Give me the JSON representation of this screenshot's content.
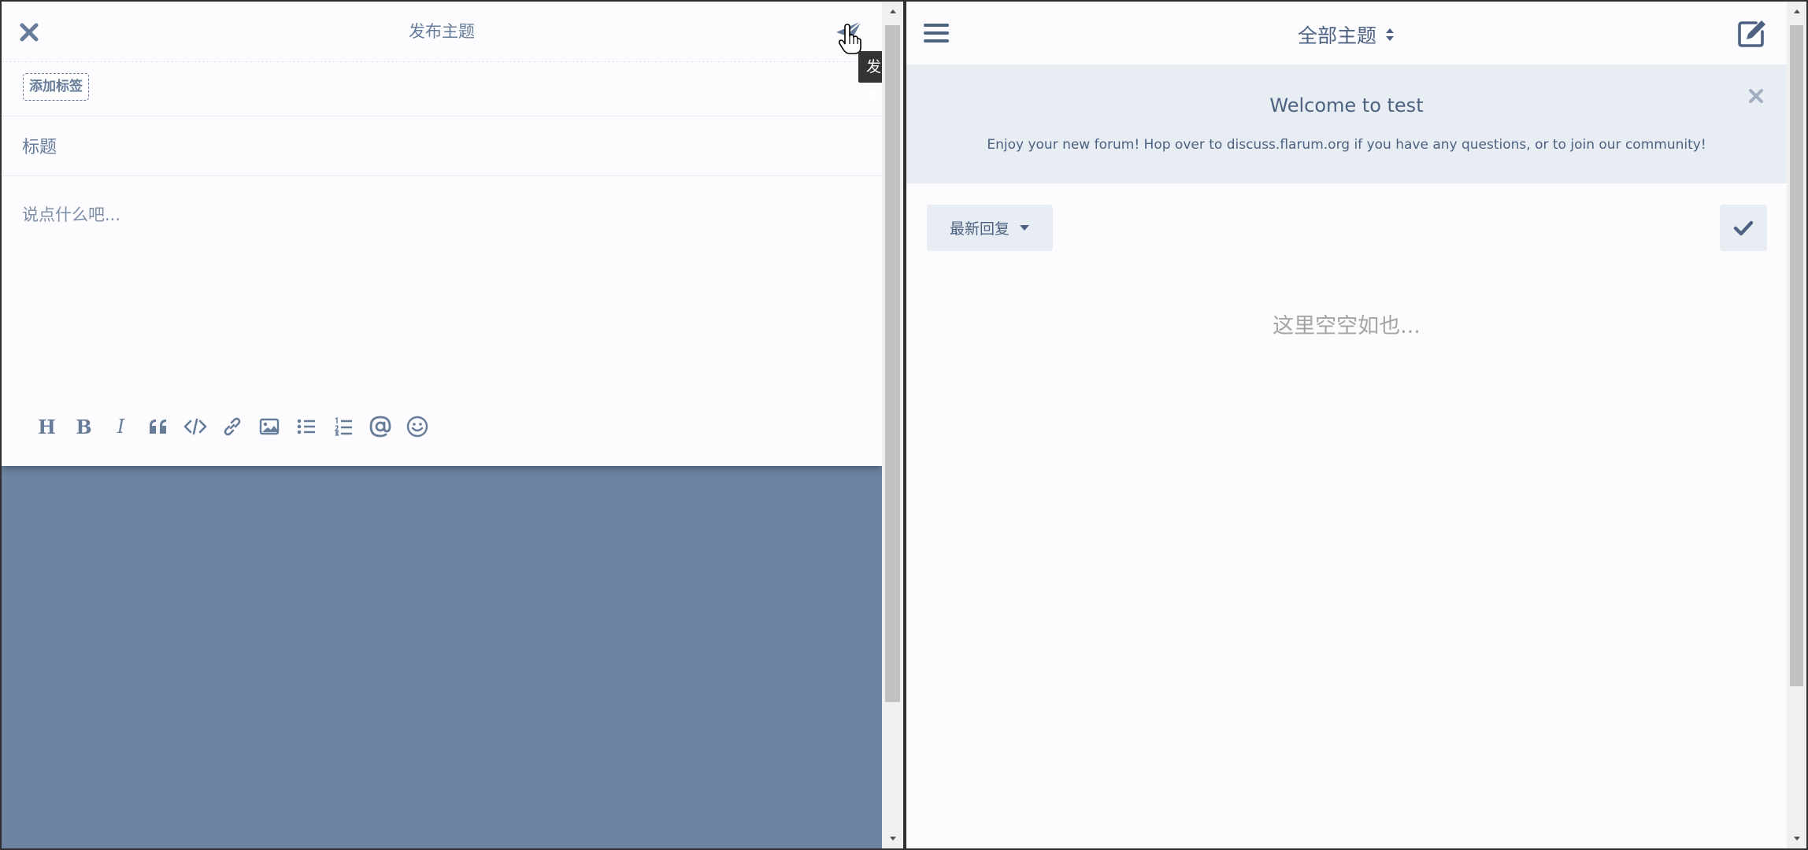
{
  "composer": {
    "title": "发布主题",
    "close_icon": "close-icon",
    "send_icon": "paper-plane-icon",
    "send_tooltip": "发布",
    "add_tag_label": "添加标签",
    "title_placeholder": "标题",
    "body_placeholder": "说点什么吧...",
    "toolbar": [
      "header-icon",
      "bold-icon",
      "italic-icon",
      "quote-icon",
      "code-icon",
      "link-icon",
      "image-icon",
      "bulleted-list-icon",
      "numbered-list-icon",
      "mention-icon",
      "emoji-icon"
    ],
    "toolbar_glyphs": {
      "header": "H",
      "bold": "B",
      "italic": "I"
    }
  },
  "forum": {
    "nav_title": "全部主题",
    "welcome_title": "Welcome to test",
    "welcome_text": "Enjoy your new forum! Hop over to discuss.flarum.org if you have any questions, or to join our community!",
    "sort_label": "最新回复",
    "empty_text": "这里空空如也..."
  },
  "colors": {
    "accent": "#4d6281",
    "text": "#667c99",
    "hero_bg": "#e7edf3",
    "backdrop": "#6e84a3"
  }
}
